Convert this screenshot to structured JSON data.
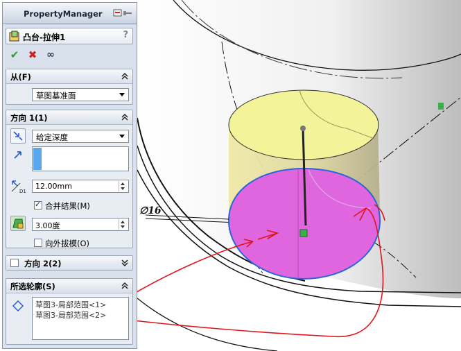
{
  "property_manager": {
    "title": "PropertyManager",
    "feature_name": "凸台-拉伸1",
    "help": "?",
    "actions": {
      "ok": "✔",
      "cancel": "✖",
      "preview": "∞"
    },
    "from": {
      "header": "从(F)",
      "value": "草图基准面"
    },
    "direction1": {
      "header": "方向 1(1)",
      "end_condition": "给定深度",
      "depth": "12.00mm",
      "depth_icon_label": "D1",
      "merge_label": "合并结果(M)",
      "merge_checked": true,
      "draft_angle": "3.00度",
      "draft_outward_label": "向外拔模(O)",
      "draft_outward_checked": false
    },
    "direction2": {
      "header": "方向 2(2)",
      "checked": false
    },
    "selected_contours": {
      "header": "所选轮廓(S)",
      "items": [
        "草图3-局部范围<1>",
        "草图3-局部范围<2>"
      ]
    }
  },
  "viewport": {
    "dimension_label": "∅16",
    "colors": {
      "top_face": "#f3f39a",
      "bottom_face": "#e066e0",
      "annotation": "#e0141b",
      "edge": "#2a66d8"
    }
  }
}
